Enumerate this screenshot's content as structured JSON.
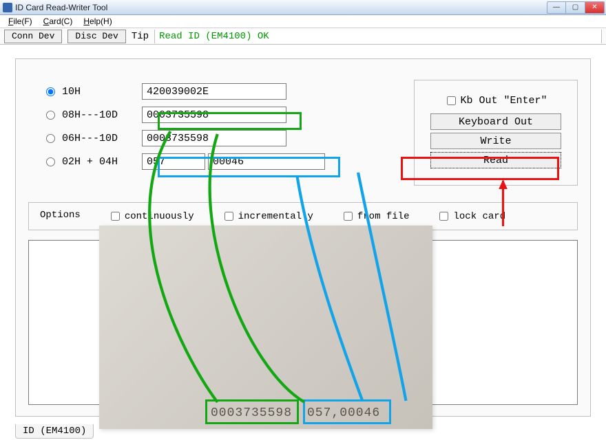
{
  "window": {
    "title": "ID Card Read-Writer Tool"
  },
  "menu": {
    "file": "File(F)",
    "card": "Card(C)",
    "help": "Help(H)"
  },
  "toolbar": {
    "conn": "Conn Dev",
    "disc": "Disc Dev",
    "tip_label": "Tip",
    "tip_text": "Read ID (EM4100) OK"
  },
  "radios": {
    "r1_label": "10H",
    "r1_value": "420039002E",
    "r2_label": "08H---10D",
    "r2_value": "0003735598",
    "r3_label": "06H---10D",
    "r3_value": "0003735598",
    "r4_label": "02H + 04H",
    "r4_value_a": "057",
    "r4_value_b": "00046"
  },
  "right": {
    "kb_enter_label": "Kb Out \"Enter\"",
    "keyboard_out": "Keyboard Out",
    "write": "Write",
    "read": "Read"
  },
  "options": {
    "legend": "Options",
    "continuously": "continuously",
    "incrementally": "incrementally",
    "from_file": "from file",
    "lock_card": "lock card"
  },
  "tab": {
    "label": "ID (EM4100)"
  },
  "card": {
    "num1": "0003735598",
    "num2": "057,00046"
  },
  "colors": {
    "highlight_green": "#13a813",
    "highlight_blue": "#13a3e8",
    "highlight_red": "#e81313",
    "status_ok": "#009900"
  }
}
